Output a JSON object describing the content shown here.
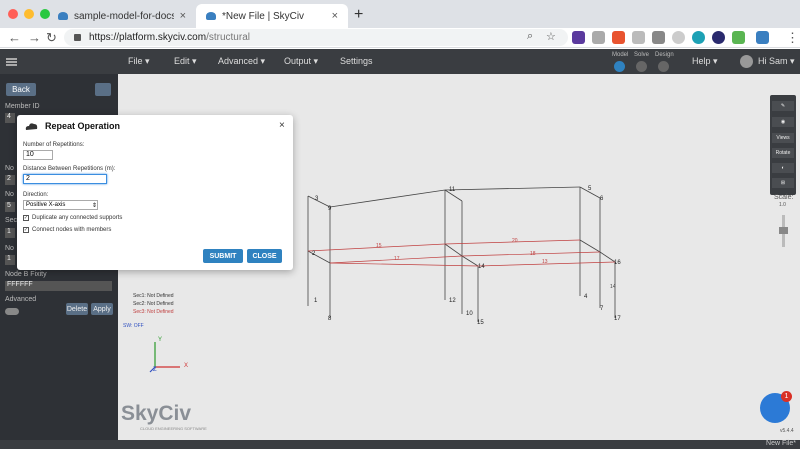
{
  "browser": {
    "tabs": [
      {
        "title": "sample-model-for-docs-concre...",
        "close": "×"
      },
      {
        "title": "*New File | SkyCiv",
        "close": "×"
      }
    ],
    "new_tab": "+",
    "url_host": "https://platform.skyciv.com",
    "url_path": "/structural"
  },
  "app": {
    "menus": [
      {
        "label": "File ▾"
      },
      {
        "label": "Edit ▾"
      },
      {
        "label": "Advanced ▾"
      },
      {
        "label": "Output ▾"
      },
      {
        "label": "Settings"
      }
    ],
    "modes": [
      {
        "label": "Model"
      },
      {
        "label": "Solve"
      },
      {
        "label": "Design"
      }
    ],
    "help": "Help ▾",
    "user": "Hi Sam ▾"
  },
  "left_panel": {
    "back": "Back",
    "member_id_label": "Member ID",
    "member_id_value": "4",
    "partial_labels": [
      "No",
      "No",
      "Sec",
      "No",
      "No"
    ],
    "partial_values": [
      "2",
      "5",
      "1",
      "1",
      "1"
    ],
    "node_b_fixity_label": "Node B Fixity",
    "node_b_fixity_value": "FFFFFF",
    "advanced": "Advanced",
    "delete": "Delete",
    "apply": "Apply"
  },
  "canvas": {
    "section_labels": [
      "Sec1: Not Defined",
      "Sec2: Not Defined",
      "Sec3: Not Defined"
    ],
    "sw_label": "SW: OFF",
    "axis_y": "Y",
    "axis_x": "X",
    "axis_z": "Z",
    "nodes": [
      {
        "label": "1"
      },
      {
        "label": "8"
      },
      {
        "label": "4"
      },
      {
        "label": "9"
      },
      {
        "label": "11"
      },
      {
        "label": "6"
      },
      {
        "label": "12"
      },
      {
        "label": "10"
      },
      {
        "label": "15"
      },
      {
        "label": "14"
      },
      {
        "label": "16"
      },
      {
        "label": "17"
      },
      {
        "label": "7"
      },
      {
        "label": "5"
      },
      {
        "label": "3"
      },
      {
        "label": "2"
      }
    ],
    "member_labels": [
      "15",
      "20",
      "17",
      "18",
      "13",
      "14"
    ],
    "watermark": "SkyCiv",
    "watermark_sub": "CLOUD ENGINEERING SOFTWARE",
    "version": "v5.4.4"
  },
  "right_tools": {
    "items": [
      "✎",
      "◉",
      "Views",
      "Rotate",
      "◐",
      "⊞"
    ],
    "scale_label": "Scale:",
    "scale_value": "1.0"
  },
  "chat": {
    "badge": "1"
  },
  "status": {
    "file": "New File*"
  },
  "dialog": {
    "title": "Repeat Operation",
    "close": "×",
    "repetitions_label": "Number of Repetitions:",
    "repetitions_value": "10",
    "distance_label": "Distance Between Repetitions (m):",
    "distance_value": "2",
    "direction_label": "Direction:",
    "direction_value": "Positive X-axis",
    "dup_supports": "Duplicate any connected supports",
    "connect_nodes": "Connect nodes with members",
    "submit": "SUBMIT",
    "close_btn": "CLOSE"
  },
  "colors": {
    "accent": "#2f82c0",
    "panel": "#2e3136",
    "canvas": "#e8e8e8",
    "member_dark": "#444444",
    "member_red": "#c04040"
  }
}
